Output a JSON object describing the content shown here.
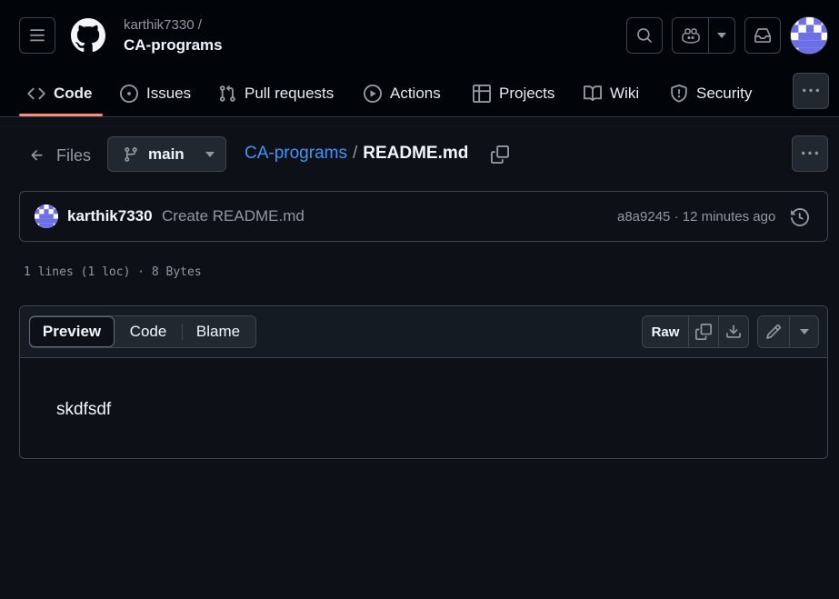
{
  "header": {
    "owner": "karthik7330 /",
    "repo": "CA-programs",
    "icons": [
      "hamburger-icon",
      "github-logo",
      "search-icon",
      "copilot-icon",
      "chevron-down-icon",
      "inbox-icon",
      "avatar"
    ]
  },
  "nav": {
    "tabs": [
      {
        "label": "Code",
        "icon": "code-icon",
        "active": true
      },
      {
        "label": "Issues",
        "icon": "issue-icon"
      },
      {
        "label": "Pull requests",
        "icon": "pull-request-icon"
      },
      {
        "label": "Actions",
        "icon": "play-icon"
      },
      {
        "label": "Projects",
        "icon": "table-icon"
      },
      {
        "label": "Wiki",
        "icon": "book-icon"
      },
      {
        "label": "Security",
        "icon": "shield-icon"
      }
    ]
  },
  "breadcrumb": {
    "files_label": "Files",
    "branch": "main",
    "repo_link": "CA-programs",
    "separator": "/",
    "filename": "README.md"
  },
  "commit": {
    "author": "karthik7330",
    "message": "Create README.md",
    "sha": "a8a9245",
    "dot": "·",
    "time": "12 minutes ago"
  },
  "file_info": "1 lines (1 loc) · 8 Bytes",
  "viewer": {
    "tabs": {
      "preview": "Preview",
      "code": "Code",
      "blame": "Blame"
    },
    "raw_label": "Raw",
    "content": "skdfsdf"
  },
  "colors": {
    "background": "#0d1117",
    "header_bg": "#010409",
    "accent_link": "#4493f8",
    "tab_underline": "#fd8c73",
    "border": "#3d444d",
    "muted_text": "#9198a1",
    "avatar_pattern": "#6e6ee6"
  }
}
